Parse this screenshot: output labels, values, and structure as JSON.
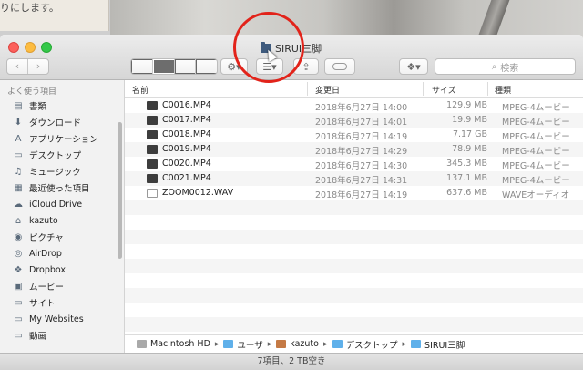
{
  "background": {
    "text": "りにします。"
  },
  "window": {
    "title": "SIRUI三脚"
  },
  "toolbar": {
    "back": "‹",
    "forward": "›",
    "search_placeholder": "検索",
    "icons": [
      "icon-view",
      "list-view",
      "column-view",
      "coverflow-view",
      "gear-icon",
      "arrange-icon",
      "share-icon",
      "tag-icon",
      "dropbox-icon",
      "search-icon"
    ]
  },
  "sidebar": {
    "header": "よく使う項目",
    "items": [
      {
        "label": "書類",
        "icon": "document-icon"
      },
      {
        "label": "ダウンロード",
        "icon": "download-icon"
      },
      {
        "label": "アプリケーション",
        "icon": "applications-icon"
      },
      {
        "label": "デスクトップ",
        "icon": "desktop-icon"
      },
      {
        "label": "ミュージック",
        "icon": "music-icon"
      },
      {
        "label": "最近使った項目",
        "icon": "recents-icon"
      },
      {
        "label": "iCloud Drive",
        "icon": "cloud-icon"
      },
      {
        "label": "kazuto",
        "icon": "home-icon"
      },
      {
        "label": "ピクチャ",
        "icon": "camera-icon"
      },
      {
        "label": "AirDrop",
        "icon": "airdrop-icon"
      },
      {
        "label": "Dropbox",
        "icon": "dropbox-icon"
      },
      {
        "label": "ムービー",
        "icon": "movie-icon"
      },
      {
        "label": "サイト",
        "icon": "folder-icon"
      },
      {
        "label": "My Websites",
        "icon": "folder-icon"
      },
      {
        "label": "動画",
        "icon": "folder-icon"
      }
    ]
  },
  "list": {
    "columns": {
      "name": "名前",
      "date": "変更日",
      "size": "サイズ",
      "kind": "種類"
    },
    "rows": [
      {
        "name": "C0016.MP4",
        "date": "2018年6月27日 14:00",
        "size": "129.9 MB",
        "kind": "MPEG-4ムービー"
      },
      {
        "name": "C0017.MP4",
        "date": "2018年6月27日 14:01",
        "size": "19.9 MB",
        "kind": "MPEG-4ムービー"
      },
      {
        "name": "C0018.MP4",
        "date": "2018年6月27日 14:19",
        "size": "7.17 GB",
        "kind": "MPEG-4ムービー"
      },
      {
        "name": "C0019.MP4",
        "date": "2018年6月27日 14:29",
        "size": "78.9 MB",
        "kind": "MPEG-4ムービー"
      },
      {
        "name": "C0020.MP4",
        "date": "2018年6月27日 14:30",
        "size": "345.3 MB",
        "kind": "MPEG-4ムービー"
      },
      {
        "name": "C0021.MP4",
        "date": "2018年6月27日 14:31",
        "size": "137.1 MB",
        "kind": "MPEG-4ムービー"
      },
      {
        "name": "ZOOM0012.WAV",
        "date": "2018年6月27日 14:19",
        "size": "637.6 MB",
        "kind": "WAVEオーディオ"
      }
    ]
  },
  "pathbar": {
    "segments": [
      "Macintosh HD",
      "ユーザ",
      "kazuto",
      "デスクトップ",
      "SIRUI三脚"
    ]
  },
  "status": {
    "text": "7項目、2 TB空き"
  }
}
